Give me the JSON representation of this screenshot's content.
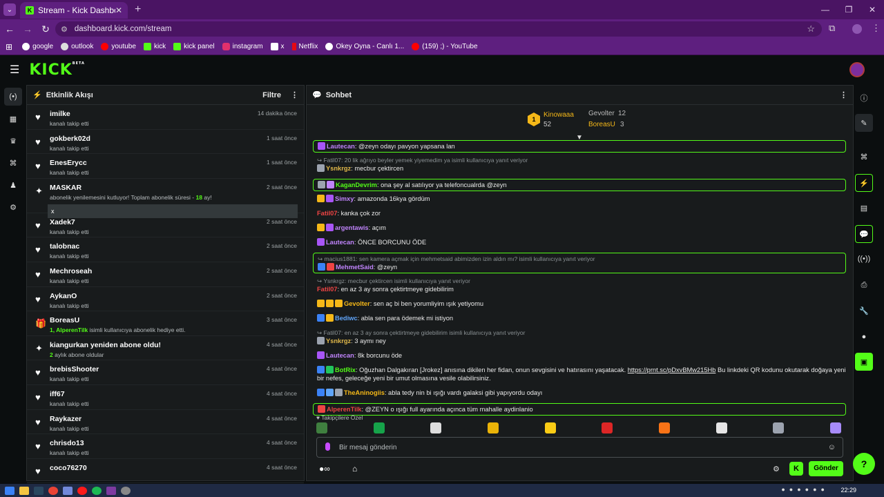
{
  "browser": {
    "tab_title": "Stream - Kick Dashboard",
    "url": "dashboard.kick.com/stream",
    "bookmarks": [
      "google",
      "outlook",
      "youtube",
      "kick",
      "kick panel",
      "instagram",
      "x",
      "Netflix",
      "Okey Oyna - Canlı 1...",
      "(159) ;) - YouTube"
    ]
  },
  "kick": {
    "logo": "KICK",
    "logo_badge": "BETA"
  },
  "activity": {
    "title": "Etkinlik Akışı",
    "filter": "Filtre",
    "events": [
      {
        "name": "imilke",
        "desc": "kanalı takip etti",
        "time": "14 dakika önce",
        "icon": "heart"
      },
      {
        "name": "gokberk02d",
        "desc": "kanalı takip etti",
        "time": "1 saat önce",
        "icon": "heart"
      },
      {
        "name": "EnesErycc",
        "desc": "kanalı takip etti",
        "time": "1 saat önce",
        "icon": "heart"
      },
      {
        "name": "MASKAR",
        "desc_pre": "abonelik yenilemesini kutluyor! Toplam abonelik süresi - ",
        "desc_num": "18",
        "desc_post": " ay!",
        "time": "2 saat önce",
        "icon": "sparkle",
        "message": "x"
      },
      {
        "name": "Xadek7",
        "desc": "kanalı takip etti",
        "time": "2 saat önce",
        "icon": "heart"
      },
      {
        "name": "talobnac",
        "desc": "kanalı takip etti",
        "time": "2 saat önce",
        "icon": "heart"
      },
      {
        "name": "Mechroseah",
        "desc": "kanalı takip etti",
        "time": "2 saat önce",
        "icon": "heart"
      },
      {
        "name": "AykanO",
        "desc": "kanalı takip etti",
        "time": "2 saat önce",
        "icon": "heart"
      },
      {
        "name": "BoreasU",
        "desc_num": "1, AlperenTilk",
        "desc_post": " isimli kullanıcıya abonelik hediye etti.",
        "time": "3 saat önce",
        "icon": "gift"
      },
      {
        "name": "kiangurkan yeniden abone oldu!",
        "desc_num": "2",
        "desc_post": " aylık abone oldular",
        "time": "4 saat önce",
        "icon": "sparkle"
      },
      {
        "name": "brebisShooter",
        "desc": "kanalı takip etti",
        "time": "4 saat önce",
        "icon": "heart"
      },
      {
        "name": "iff67",
        "desc": "kanalı takip etti",
        "time": "4 saat önce",
        "icon": "heart"
      },
      {
        "name": "Raykazer",
        "desc": "kanalı takip etti",
        "time": "4 saat önce",
        "icon": "heart"
      },
      {
        "name": "chrisdo13",
        "desc": "kanalı takip etti",
        "time": "4 saat önce",
        "icon": "heart"
      },
      {
        "name": "coco76270",
        "desc": "",
        "time": "4 saat önce",
        "icon": "heart"
      }
    ]
  },
  "chat": {
    "title": "Sohbet",
    "pinned": {
      "first": {
        "rank": "1",
        "name": "Kinowaaa",
        "value": "52"
      },
      "second": {
        "name": "Gevolter",
        "value": "12"
      },
      "third": {
        "name": "BoreasU",
        "value": "3"
      }
    },
    "messages": [
      {
        "user": "Lautecan",
        "color": "#c084fc",
        "text": ": @zeyn odayı pavyon yapsana lan",
        "box": true,
        "badges": [
          "#a855f7"
        ]
      },
      {
        "reply": "Fatil07: 20 lik ağrıyo beyler yemek yiyemedim ya isimli kullanıcıya yanıt veriyor",
        "user": "Ysnkrgz",
        "color": "#e0b84a",
        "text": ": mecbur çektircen",
        "badges": [
          "#9ca3af"
        ]
      },
      {
        "user": "KaganDevrim",
        "color": "#53fc18",
        "text": ": ona şey al satılıyor ya telefoncualrda @zeyn",
        "box": true,
        "badges": [
          "#9ca3af",
          "#c084fc"
        ]
      },
      {
        "user": "Simxy",
        "color": "#c084fc",
        "text": ": amazonda 16kya gördüm",
        "badges": [
          "#f5b818",
          "#a855f7"
        ]
      },
      {
        "user": "Fatil07",
        "color": "#ef4444",
        "text": ": kanka çok zor",
        "badges": []
      },
      {
        "user": "argentawis",
        "color": "#c084fc",
        "text": ": açım",
        "badges": [
          "#f5b818",
          "#a855f7"
        ]
      },
      {
        "user": "Lautecan",
        "color": "#c084fc",
        "text": ": ÖNCE BORCUNU ÖDE",
        "badges": [
          "#a855f7"
        ]
      },
      {
        "reply": "macius1881: sen kamera açmak için mehmetsaid abimizden izin aldın mı? isimli kullanıcıya yanıt veriyor",
        "user": "MehmetSaid",
        "color": "#c084fc",
        "text": ": @zeyn",
        "box": true,
        "badges": [
          "#3b82f6",
          "#ef4444"
        ]
      },
      {
        "reply": "Ysnkrgz: mecbur çektircen isimli kullanıcıya yanıt veriyor",
        "user": "Fatil07",
        "color": "#ef4444",
        "text": ": en az 3 ay sonra çektirtmeye gidebilirim",
        "badges": []
      },
      {
        "user": "Gevolter",
        "color": "#f5b818",
        "text": ": sen aç bi ben yorumliyim ışık yetiyomu",
        "badges": [
          "#f5b818",
          "#f5b818",
          "#f5b818"
        ]
      },
      {
        "user": "Bediwc",
        "color": "#60a5fa",
        "text": ": abla sen para ödemek mi istiyon",
        "badges": [
          "#3b82f6",
          "#f5b818"
        ]
      },
      {
        "reply": "Fatil07: en az 3 ay sonra çektirtmeye gidebilirim isimli kullanıcıya yanıt veriyor",
        "user": "Ysnkrgz",
        "color": "#e0b84a",
        "text": ": 3 aymı ney",
        "badges": [
          "#9ca3af"
        ]
      },
      {
        "user": "Lautecan",
        "color": "#c084fc",
        "text": ": 8k borcunu öde",
        "badges": [
          "#a855f7"
        ]
      },
      {
        "user": "BotRix",
        "color": "#53fc18",
        "text": ": Oğuzhan Dalgakıran [Jrokez] anısına dikilen her fidan, onun sevgisini ve hatırasını yaşatacak. ",
        "link": "https://prnt.sc/pDxvBMw215Hb",
        "text2": " Bu linkdeki QR kodunu okutarak doğaya yeni bir nefes, geleceğe yeni bir umut olmasına vesile olabilirsiniz.",
        "badges": [
          "#3b82f6",
          "#22c55e"
        ]
      },
      {
        "user": "TheAninogiis",
        "color": "#f5b818",
        "text": ": abla tedy nin bi ışığı vardı galaksi gibi yapıyordu odayı",
        "badges": [
          "#3b82f6",
          "#60a5fa",
          "#9ca3af"
        ]
      },
      {
        "user": "AlperenTilk",
        "color": "#ef4444",
        "text": ": @ZEYN o ışığı full ayarında açınca tüm mahalle aydinlanio",
        "box": true,
        "badges": [
          "#ef4444"
        ]
      }
    ],
    "followers_only": "Takipçilere Özel",
    "input_placeholder": "Bir mesaj gönderin",
    "send": "Gönder"
  },
  "taskbar": {
    "time": "22:29"
  },
  "colors": {
    "accent": "#53fc18",
    "browser": "#5e1f7f",
    "panel": "#181b1c"
  }
}
